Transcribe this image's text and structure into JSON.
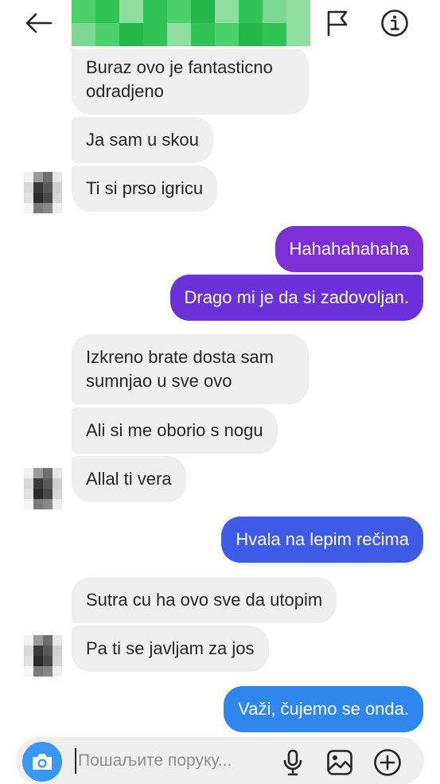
{
  "header": {
    "back_icon": "arrow-left-icon",
    "flag_icon": "flag-icon",
    "info_icon": "info-icon",
    "redacted_colors": [
      "#4cd16a",
      "#2fc356",
      "#8fdd9f",
      "#24b84a",
      "#7cd88e"
    ]
  },
  "messages": [
    {
      "side": "in",
      "text": "Buraz ovo je fantasticno odradjeno"
    },
    {
      "side": "in",
      "text": "Ja sam u skou"
    },
    {
      "side": "in",
      "text": "Ti si prso igricu"
    },
    {
      "side": "out",
      "text": "Hahahahahaha",
      "color": "#7d2fd6"
    },
    {
      "side": "out",
      "text": "Drago mi je da si zadovoljan.",
      "color": "#6a30d9"
    },
    {
      "side": "in",
      "text": "Izkreno brate dosta sam sumnjao u sve ovo"
    },
    {
      "side": "in",
      "text": "Ali si me oborio s nogu"
    },
    {
      "side": "in",
      "text": "Allal ti vera"
    },
    {
      "side": "out",
      "text": "Hvala na lepim rečima",
      "color": "#3d5be6"
    },
    {
      "side": "in",
      "text": "Sutra cu ha ovo sve da utopim"
    },
    {
      "side": "in",
      "text": "Pa ti se javljam za jos"
    },
    {
      "side": "out",
      "text": "Važi, čujemo se onda.",
      "color": "#2f86ec"
    }
  ],
  "composer": {
    "placeholder": "Пошаљите поруку...",
    "value": "",
    "camera_icon": "camera-icon",
    "mic_icon": "microphone-icon",
    "gallery_icon": "image-gallery-icon",
    "add_icon": "plus-circle-icon",
    "accent": "#3897f0"
  },
  "colors": {
    "incoming_bubble": "#efeff0",
    "text": "#262626",
    "background": "#ffffff"
  }
}
